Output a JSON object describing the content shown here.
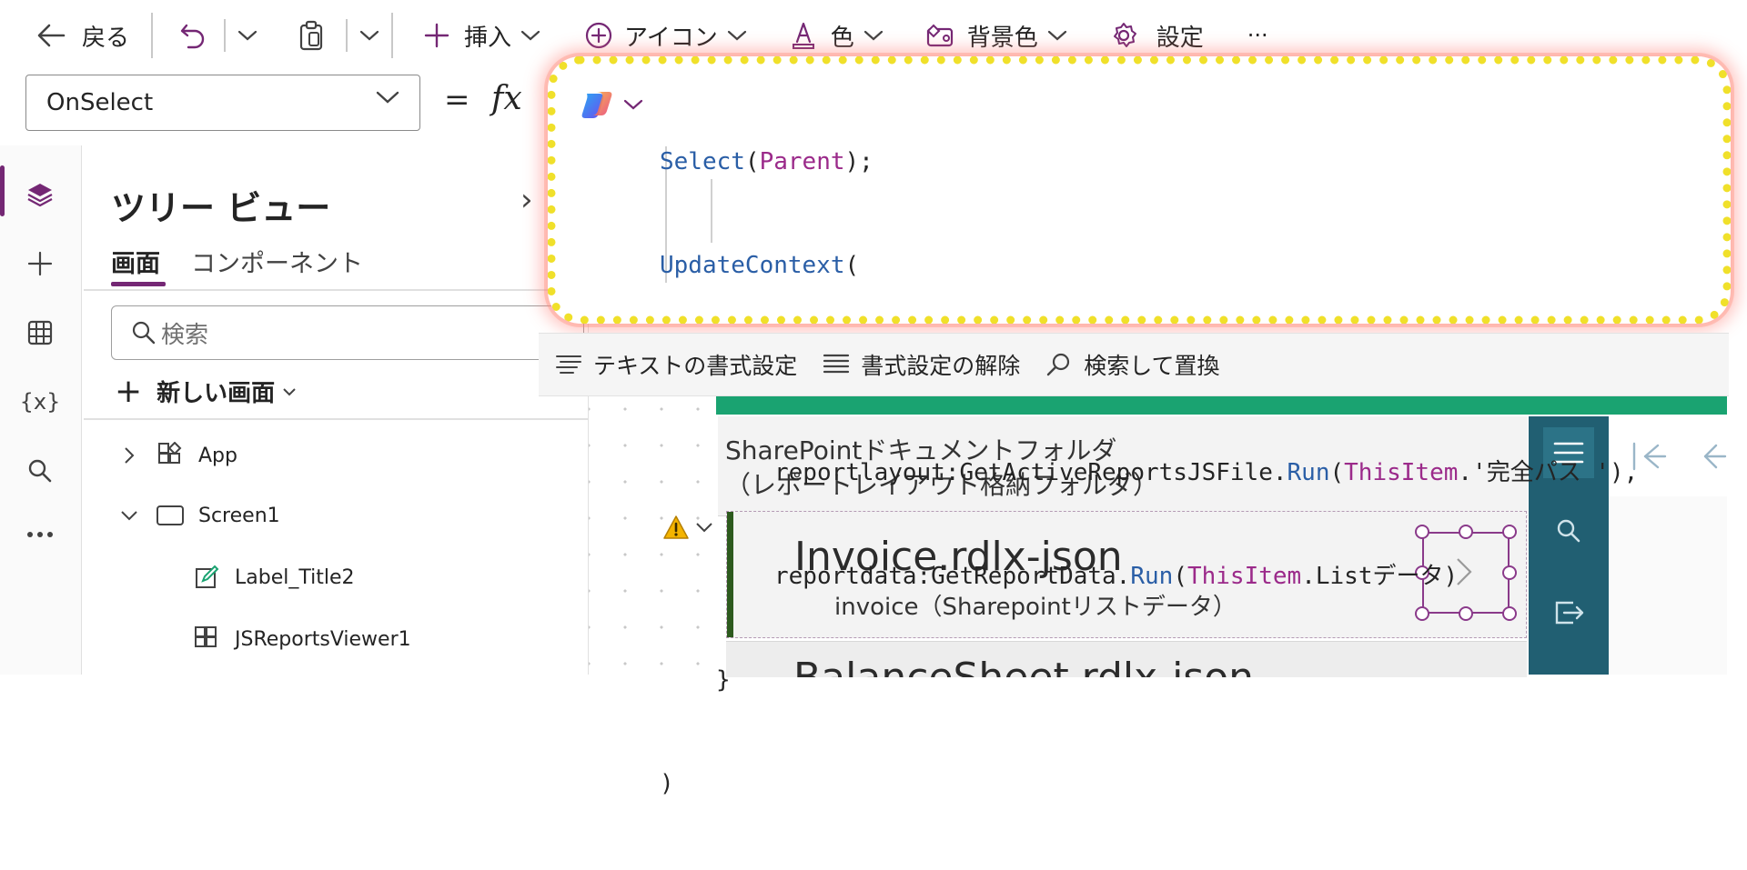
{
  "toolbar": {
    "back_label": "戻る",
    "insert_label": "挿入",
    "icons_label": "アイコン",
    "color_label": "色",
    "background_label": "背景色",
    "settings_label": "設定",
    "more_label": "···"
  },
  "formula": {
    "property": "OnSelect",
    "equals": "=",
    "fx": "fx",
    "code": {
      "l1_fn": "Select",
      "l1_p1": "(",
      "l1_kw": "Parent",
      "l1_p2": ");",
      "l2_fn": "UpdateContext",
      "l2_p": "(",
      "l3": "{",
      "l4_a": "reportlayout:GetActiveReportsJSFile.",
      "l4_fn": "Run",
      "l4_b": "(",
      "l4_kw": "ThisItem",
      "l4_c": ".'完全パス '),",
      "l5_a": "reportdata:GetReportData.",
      "l5_fn": "Run",
      "l5_b": "(",
      "l5_kw": "ThisItem",
      "l5_c": ".Listデータ)",
      "l6": "}",
      "l7": ")"
    }
  },
  "format_bar": {
    "format_text": "テキストの書式設定",
    "remove_format": "書式設定の解除",
    "find_replace": "検索して置換"
  },
  "tree": {
    "title": "ツリー ビュー",
    "tab_screens": "画面",
    "tab_components": "コンポーネント",
    "search_placeholder": "検索",
    "new_screen": "新しい画面",
    "nodes": [
      "App",
      "Screen1",
      "Label_Title2",
      "JSReportsViewer1"
    ]
  },
  "canvas": {
    "header_line1": "SharePointドキュメントフォルダ",
    "header_line2": "（レポートレイアウト格納フォルダ）",
    "items": [
      {
        "title": "Invoice.rdlx-json",
        "subtitle": "invoice（Sharepointリストデータ）"
      },
      {
        "title": "BalanceSheet.rdlx-json"
      }
    ]
  },
  "colors": {
    "accent": "#742774",
    "app_header": "#1aa371",
    "side_nav": "#215f72",
    "function": "#2a5ea6",
    "keyword": "#9b2a8a",
    "highlight_border": "#f0e02a"
  }
}
